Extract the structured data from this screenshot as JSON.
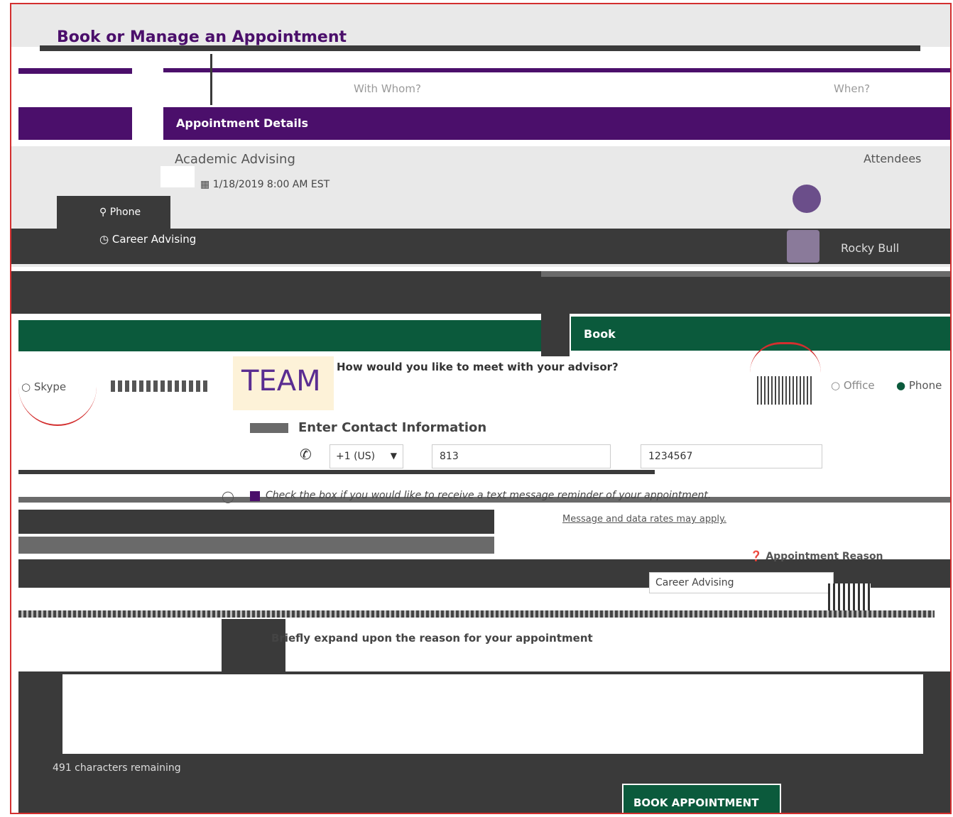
{
  "header": {
    "title": "Book or Manage an Appointment"
  },
  "steps": {
    "with_whom": "With Whom?",
    "when": "When?"
  },
  "details": {
    "heading": "Appointment Details",
    "service": "Academic Advising",
    "attendees_label": "Attendees",
    "datetime": "1/18/2019 8:00 AM EST",
    "location": "Phone",
    "category": "Career Advising",
    "attendee_name": "Rocky Bull"
  },
  "book": {
    "heading": "Book",
    "question": "How would you like to meet with your advisor?",
    "options": [
      "Skype",
      "Office",
      "Phone"
    ],
    "team_label": "TEAM",
    "contact_heading": "Enter Contact Information",
    "country_code": "+1 (US)",
    "area_code": "813",
    "phone_number": "1234567",
    "sms_checkbox": "Check the box if you would like to receive a text message reminder of your appointment.",
    "sms_note": "Message and data rates may apply.",
    "reason_label": "Appointment Reason",
    "reason_value": "Career Advising",
    "expand_label": "Briefly expand upon the reason for your appointment",
    "chars_remaining": "491 characters remaining",
    "submit_label": "BOOK APPOINTMENT"
  },
  "colors": {
    "purple": "#4b0f6b",
    "green": "#0b5a3c",
    "red_border": "#d32f2f",
    "team_bg": "#fdf2d8",
    "team_text": "#5a2d91"
  }
}
